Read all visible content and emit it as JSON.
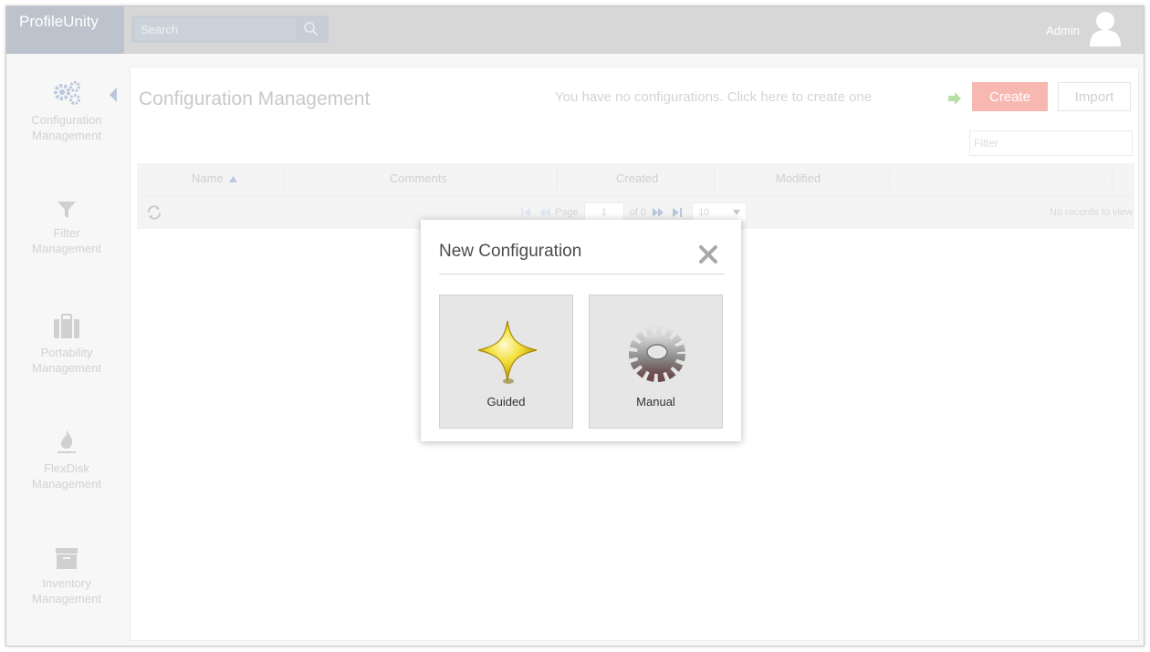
{
  "app": {
    "name": "ProfileUnity",
    "user": "Admin"
  },
  "search": {
    "placeholder": "Search"
  },
  "sidebar": {
    "items": [
      {
        "label_line1": "Configuration",
        "label_line2": "Management",
        "icon": "gears-icon"
      },
      {
        "label_line1": "Filter",
        "label_line2": "Management",
        "icon": "funnel-icon"
      },
      {
        "label_line1": "Portability",
        "label_line2": "Management",
        "icon": "suitcase-icon"
      },
      {
        "label_line1": "FlexDisk",
        "label_line2": "Management",
        "icon": "flame-icon"
      },
      {
        "label_line1": "Inventory",
        "label_line2": "Management",
        "icon": "archive-box-icon"
      }
    ]
  },
  "main": {
    "title": "Configuration Management",
    "hint": "You have no configurations. Click here to create one",
    "create_label": "Create",
    "import_label": "Import",
    "filter_placeholder": "Filter"
  },
  "grid": {
    "columns": [
      "Name",
      "Comments",
      "Created",
      "Modified"
    ],
    "sort_column": "Name",
    "pager": {
      "page_label": "Page",
      "page_value": "1",
      "of_label": "of 0",
      "rows_per_page": "10"
    },
    "empty_text": "No records to view"
  },
  "modal": {
    "title": "New Configuration",
    "options": [
      {
        "label": "Guided",
        "icon": "star-sparkle-icon"
      },
      {
        "label": "Manual",
        "icon": "gear-icon"
      }
    ]
  },
  "colors": {
    "create_button": "#f7b8b2",
    "logo_bg": "#bcc3cc",
    "topbar_bg": "#d7d7d7",
    "hint_arrow": "#b8e0a6"
  }
}
